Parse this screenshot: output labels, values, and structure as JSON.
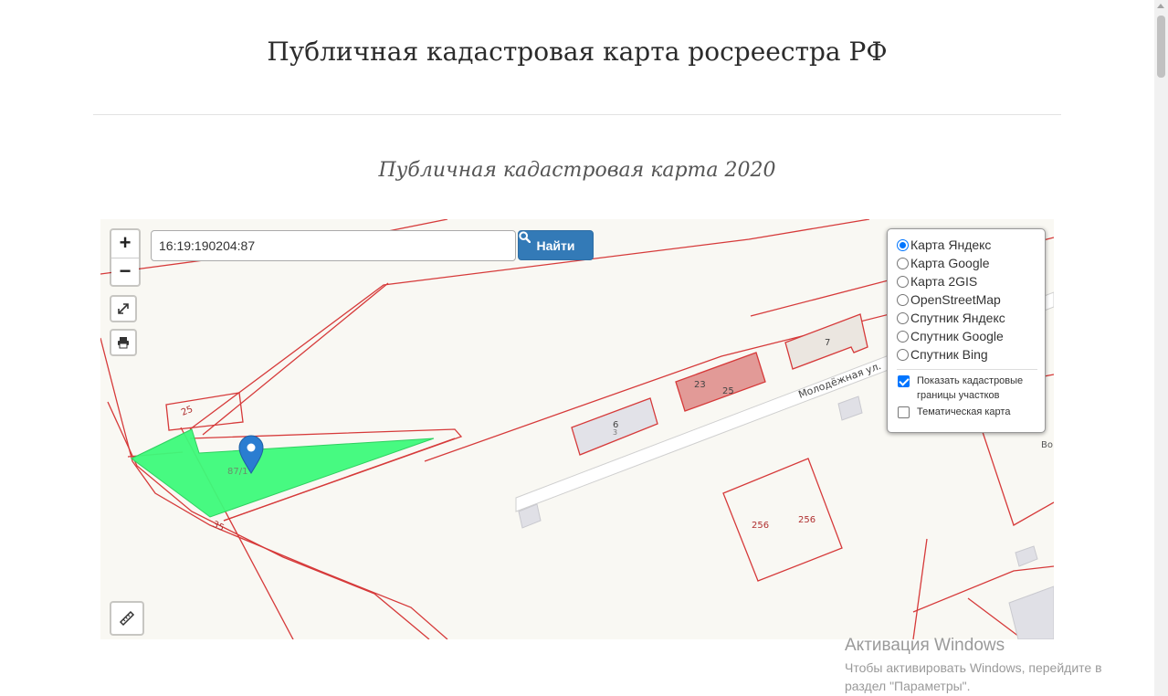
{
  "page": {
    "title": "Публичная кадастровая карта росреестра РФ",
    "section_title": "Публичная кадастровая карта 2020"
  },
  "map": {
    "search": {
      "value": "16:19:190204:87",
      "button_label": "Найти"
    },
    "zoom": {
      "in_label": "+",
      "out_label": "−"
    },
    "labels": {
      "street": "Молодёжная ул.",
      "parcel_25_left": "25",
      "parcel_87": "87/1",
      "parcel_35": "35",
      "building_6": "6",
      "building_3": "3",
      "building_23": "23",
      "building_25": "25",
      "building_7": "7",
      "plot_256_a": "256",
      "plot_256_b": "256",
      "edge_vo": "Во"
    },
    "layers": {
      "options": [
        {
          "label": "Карта Яндекс",
          "selected": true
        },
        {
          "label": "Карта Google",
          "selected": false
        },
        {
          "label": "Карта 2GIS",
          "selected": false
        },
        {
          "label": "OpenStreetMap",
          "selected": false
        },
        {
          "label": "Спутник Яндекс",
          "selected": false
        },
        {
          "label": "Спутник Google",
          "selected": false
        },
        {
          "label": "Спутник Bing",
          "selected": false
        }
      ],
      "overlays": [
        {
          "label": "Показать кадастровые границы участков",
          "checked": true
        },
        {
          "label": "Тематическая карта",
          "checked": false
        }
      ]
    },
    "colors": {
      "boundary": "#d63a3a",
      "parcel_selected": "#3dfa7a",
      "building_highlight": "#e29a97",
      "building_gray": "#e2e2e8",
      "marker": "#2a7dd1"
    }
  },
  "watermark": {
    "title": "Активация Windows",
    "line1": "Чтобы активировать Windows, перейдите в",
    "line2": "раздел \"Параметры\"."
  }
}
